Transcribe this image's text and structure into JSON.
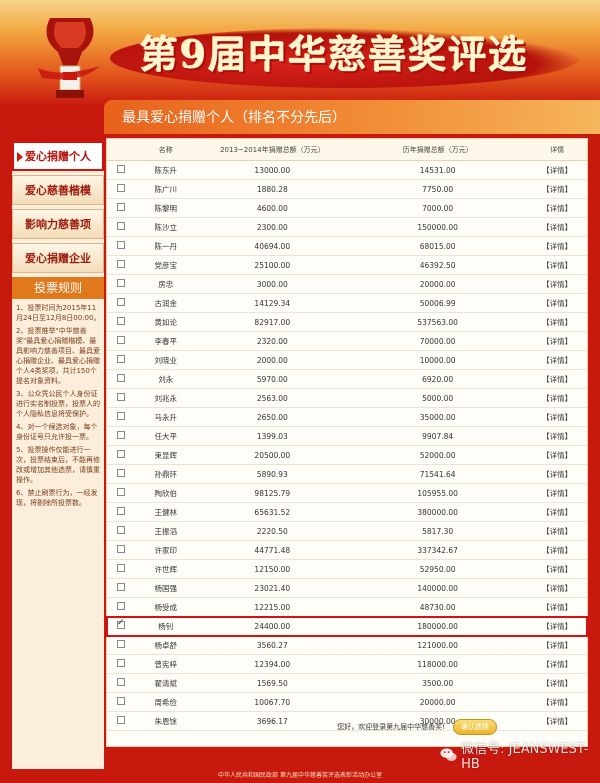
{
  "banner": {
    "title": "第9届中华慈善奖评选"
  },
  "section": {
    "title": "最具爱心捐赠个人（排名不分先后）"
  },
  "sidebar": {
    "items": [
      {
        "label": "爱心捐赠个人",
        "active": true
      },
      {
        "label": "爱心慈善楷模",
        "active": false
      },
      {
        "label": "影响力慈善项",
        "active": false
      },
      {
        "label": "爱心捐赠企业",
        "active": false
      }
    ],
    "rules_title": "投票规则",
    "rules": [
      "1、投票时间为2015年11月24日至12月8日00:00。",
      "2、投票推举\"中华慈善奖\"最具爱心捐赠楷模、最具影响力慈善项目、最具爱心捐赠企业、最具爱心捐赠个人4类奖项，共计150个提名对象资料。",
      "3、公众凭公民个人身份证进行实名制投票，投票人的个人隐私信息将受保护。",
      "4、对一个候选对象，每个身份证号只允许投一票。",
      "5、投票操作仅能进行一次，投票结束后，不能再修改或增加其他选票，请慎重操作。",
      "6、禁止刷票行为，一经发现，将剔除所投票数。"
    ]
  },
  "table": {
    "headers": {
      "name": "名称",
      "col_a": "2013~2014年捐赠总额（万元）",
      "col_b": "历年捐赠总额（万元）",
      "detail": "详情"
    },
    "detail_label": "【详情】",
    "rows": [
      {
        "name": "陈东升",
        "a": "13000.00",
        "b": "14531.00",
        "checked": false
      },
      {
        "name": "陈广川",
        "a": "1880.28",
        "b": "7750.00",
        "checked": false
      },
      {
        "name": "陈黎明",
        "a": "4600.00",
        "b": "7000.00",
        "checked": false
      },
      {
        "name": "陈沙立",
        "a": "2300.00",
        "b": "150000.00",
        "checked": false
      },
      {
        "name": "陈一丹",
        "a": "40694.00",
        "b": "68015.00",
        "checked": false
      },
      {
        "name": "党彦宝",
        "a": "25100.00",
        "b": "46392.50",
        "checked": false
      },
      {
        "name": "房忠",
        "a": "3000.00",
        "b": "20000.00",
        "checked": false
      },
      {
        "name": "古润金",
        "a": "14129.34",
        "b": "50006.99",
        "checked": false
      },
      {
        "name": "黄如论",
        "a": "82917.00",
        "b": "537563.00",
        "checked": false
      },
      {
        "name": "李春平",
        "a": "2320.00",
        "b": "70000.00",
        "checked": false
      },
      {
        "name": "刘晓业",
        "a": "2000.00",
        "b": "10000.00",
        "checked": false
      },
      {
        "name": "刘永",
        "a": "5970.00",
        "b": "6920.00",
        "checked": false
      },
      {
        "name": "刘兆永",
        "a": "2563.00",
        "b": "5000.00",
        "checked": false
      },
      {
        "name": "马永升",
        "a": "2650.00",
        "b": "35000.00",
        "checked": false
      },
      {
        "name": "任大平",
        "a": "1399.03",
        "b": "9907.84",
        "checked": false
      },
      {
        "name": "束显辉",
        "a": "20500.00",
        "b": "52000.00",
        "checked": false
      },
      {
        "name": "孙鼎环",
        "a": "5890.93",
        "b": "71541.64",
        "checked": false
      },
      {
        "name": "陶欣伯",
        "a": "98125.79",
        "b": "105955.00",
        "checked": false
      },
      {
        "name": "王健林",
        "a": "65631.52",
        "b": "380000.00",
        "checked": false
      },
      {
        "name": "王振滔",
        "a": "2220.50",
        "b": "5817.30",
        "checked": false
      },
      {
        "name": "许家印",
        "a": "44771.48",
        "b": "337342.67",
        "checked": false
      },
      {
        "name": "许世辉",
        "a": "12150.00",
        "b": "52950.00",
        "checked": false
      },
      {
        "name": "杨国强",
        "a": "23021.40",
        "b": "140000.00",
        "checked": false
      },
      {
        "name": "杨受成",
        "a": "12215.00",
        "b": "48730.00",
        "checked": false
      },
      {
        "name": "杨钊",
        "a": "24400.00",
        "b": "180000.00",
        "checked": true
      },
      {
        "name": "杨卓舒",
        "a": "3560.27",
        "b": "121000.00",
        "checked": false
      },
      {
        "name": "曾宪梓",
        "a": "12394.00",
        "b": "118000.00",
        "checked": false
      },
      {
        "name": "翟清斌",
        "a": "1569.50",
        "b": "3500.00",
        "checked": false
      },
      {
        "name": "周希俭",
        "a": "10067.70",
        "b": "20000.00",
        "checked": false
      },
      {
        "name": "朱恩馀",
        "a": "3696.17",
        "b": "30000.00",
        "checked": false
      }
    ]
  },
  "footer": {
    "message": "您好，欢迎登录第九届中华慈善奖!",
    "confirm_label": "确认选择",
    "bottom_text": "中华人民共和国民政部 第九届中华慈善奖评选表彰活动办公室"
  },
  "watermark": {
    "text": "微信号: JEANSWEST-HB"
  },
  "colors": {
    "accent_red": "#d4120e",
    "banner_orange": "#e8621c",
    "sidebar_bg": "#fbeeda"
  },
  "icons": {
    "trophy": "trophy-icon",
    "wechat": "wechat-icon"
  }
}
